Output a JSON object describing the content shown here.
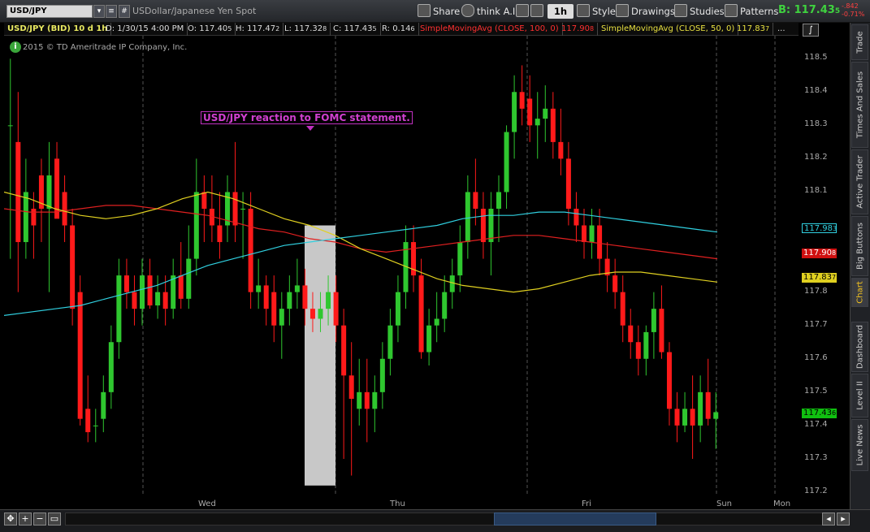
{
  "toolbar": {
    "symbol": "USD/JPY",
    "description": "USDollar/Japanese Yen Spot",
    "share_label": "Share",
    "think_label": "think A.I.",
    "interval_label": "1h",
    "style_label": "Style",
    "drawings_label": "Drawings",
    "studies_label": "Studies",
    "patterns_label": "Patterns",
    "bid_label": "B: 117.43",
    "bid_small": "5",
    "change_pct_top": "-.842",
    "change_pct_bottom": "-0.71%"
  },
  "infobar": {
    "title": "USD/JPY (BID) 10 d 1h",
    "datetime": "D: 1/30/15 4:00 PM",
    "open": "O: 117.40",
    "open_small": "5",
    "high": "H: 117.47",
    "high_small": "2",
    "low": "L: 117.32",
    "low_small": "8",
    "close": "C: 117.43",
    "close_small": "5",
    "range": "R: 0.14",
    "range_small": "6",
    "sma100_label": "SimpleMovingAvg (CLOSE, 100, 0)",
    "sma100_value": "117.90",
    "sma100_small": "8",
    "sma50_label": "SimpleMovingAvg (CLOSE, 50, 0)",
    "sma50_value": "117.83",
    "sma50_small": "7",
    "more": "..."
  },
  "copyright": "2015 © TD Ameritrade IP Company, Inc.",
  "annotation": "USD/JPY reaction to FOMC statement.",
  "price_labels": [
    "118.5",
    "118.4",
    "118.3",
    "118.2",
    "118.1",
    "117.8",
    "117.7",
    "117.6",
    "117.5",
    "117.4",
    "117.3",
    "117.2"
  ],
  "price_tags": {
    "cyan": "117.98",
    "cyan_small": "3",
    "red": "117.90",
    "red_small": "8",
    "yellow": "117.83",
    "yellow_small": "7",
    "green": "117.43",
    "green_small": "6"
  },
  "x_labels": [
    "Wed",
    "Thu",
    "Fri",
    "Sun",
    "Mon"
  ],
  "side_tabs": [
    "Trade",
    "Times And Sales",
    "Active Trader",
    "Big Buttons",
    "Chart",
    "Dashboard",
    "Level II",
    "Live News"
  ],
  "colors": {
    "up": "#2fc72f",
    "down": "#ff1a1a",
    "sma_red": "#e02020",
    "sma_yellow": "#e0d020",
    "sma_cyan": "#30d0e0",
    "highlight": "#c8c8c8"
  },
  "chart_data": {
    "type": "candlestick",
    "ylim": [
      117.2,
      118.52
    ],
    "candles": [
      [
        118.3,
        118.5,
        117.9,
        118.3
      ],
      [
        118.25,
        118.4,
        117.8,
        117.95
      ],
      [
        117.95,
        118.2,
        117.9,
        118.1
      ],
      [
        118.05,
        118.1,
        117.9,
        118.0
      ],
      [
        118.15,
        118.2,
        117.95,
        118.05
      ],
      [
        118.05,
        118.25,
        117.8,
        118.15
      ],
      [
        118.2,
        118.25,
        118.05,
        118.02
      ],
      [
        118.1,
        118.15,
        117.95,
        118.0
      ],
      [
        118.0,
        118.05,
        117.7,
        117.75
      ],
      [
        117.8,
        117.85,
        117.4,
        117.42
      ],
      [
        117.45,
        117.55,
        117.35,
        117.38
      ],
      [
        117.4,
        117.45,
        117.35,
        117.4
      ],
      [
        117.42,
        117.55,
        117.38,
        117.5
      ],
      [
        117.5,
        117.7,
        117.45,
        117.65
      ],
      [
        117.65,
        117.9,
        117.6,
        117.85
      ],
      [
        117.85,
        117.9,
        117.75,
        117.8
      ],
      [
        117.8,
        117.85,
        117.7,
        117.75
      ],
      [
        117.75,
        117.9,
        117.7,
        117.85
      ],
      [
        117.85,
        117.9,
        117.75,
        117.76
      ],
      [
        117.76,
        117.85,
        117.72,
        117.8
      ],
      [
        117.8,
        117.85,
        117.7,
        117.75
      ],
      [
        117.75,
        117.9,
        117.72,
        117.85
      ],
      [
        117.85,
        117.95,
        117.75,
        117.78
      ],
      [
        117.78,
        118.0,
        117.75,
        117.9
      ],
      [
        117.9,
        118.2,
        117.85,
        118.1
      ],
      [
        118.1,
        118.15,
        117.95,
        118.05
      ],
      [
        118.05,
        118.15,
        117.95,
        118.0
      ],
      [
        118.0,
        118.1,
        117.9,
        117.95
      ],
      [
        118.0,
        118.15,
        117.95,
        118.1
      ],
      [
        118.1,
        118.25,
        117.95,
        118.0
      ],
      [
        118.05,
        118.1,
        117.9,
        118.05
      ],
      [
        118.05,
        118.1,
        117.75,
        117.8
      ],
      [
        117.8,
        117.9,
        117.75,
        117.82
      ],
      [
        117.82,
        117.85,
        117.7,
        117.75
      ],
      [
        117.8,
        117.85,
        117.65,
        117.7
      ],
      [
        117.7,
        117.8,
        117.6,
        117.75
      ],
      [
        117.75,
        117.85,
        117.7,
        117.8
      ],
      [
        117.8,
        117.9,
        117.75,
        117.82
      ],
      [
        117.82,
        117.87,
        117.7,
        117.75
      ],
      [
        117.75,
        117.8,
        117.68,
        117.72
      ],
      [
        117.72,
        117.8,
        117.68,
        117.75
      ],
      [
        117.75,
        117.85,
        117.7,
        117.8
      ],
      [
        117.8,
        117.85,
        117.65,
        117.7
      ],
      [
        117.7,
        117.75,
        117.3,
        117.55
      ],
      [
        117.55,
        117.65,
        117.25,
        117.48
      ],
      [
        117.45,
        117.6,
        117.4,
        117.5
      ],
      [
        117.5,
        117.6,
        117.35,
        117.45
      ],
      [
        117.45,
        117.55,
        117.38,
        117.5
      ],
      [
        117.5,
        117.65,
        117.45,
        117.6
      ],
      [
        117.6,
        117.75,
        117.55,
        117.7
      ],
      [
        117.7,
        117.85,
        117.65,
        117.8
      ],
      [
        117.8,
        118.0,
        117.75,
        117.95
      ],
      [
        117.95,
        118.0,
        117.8,
        117.85
      ],
      [
        117.85,
        117.9,
        117.6,
        117.62
      ],
      [
        117.62,
        117.75,
        117.58,
        117.7
      ],
      [
        117.7,
        117.8,
        117.65,
        117.72
      ],
      [
        117.72,
        117.85,
        117.68,
        117.8
      ],
      [
        117.8,
        117.9,
        117.75,
        117.85
      ],
      [
        117.85,
        118.0,
        117.8,
        117.95
      ],
      [
        117.95,
        118.15,
        117.9,
        118.1
      ],
      [
        118.1,
        118.2,
        118.0,
        118.05
      ],
      [
        118.05,
        118.1,
        117.9,
        117.95
      ],
      [
        117.95,
        118.1,
        117.85,
        118.05
      ],
      [
        118.05,
        118.15,
        117.95,
        118.1
      ],
      [
        118.1,
        118.3,
        118.05,
        118.28
      ],
      [
        118.28,
        118.45,
        118.2,
        118.4
      ],
      [
        118.4,
        118.48,
        118.3,
        118.35
      ],
      [
        118.38,
        118.45,
        118.25,
        118.3
      ],
      [
        118.3,
        118.4,
        118.2,
        118.32
      ],
      [
        118.32,
        118.42,
        118.25,
        118.35
      ],
      [
        118.35,
        118.4,
        118.2,
        118.25
      ],
      [
        118.25,
        118.35,
        118.15,
        118.2
      ],
      [
        118.2,
        118.25,
        118.0,
        118.05
      ],
      [
        118.05,
        118.1,
        117.95,
        118.0
      ],
      [
        118.0,
        118.05,
        117.9,
        117.95
      ],
      [
        117.95,
        118.05,
        117.9,
        118.0
      ],
      [
        118.0,
        118.05,
        117.85,
        117.9
      ],
      [
        117.9,
        117.95,
        117.8,
        117.85
      ],
      [
        117.85,
        117.9,
        117.75,
        117.8
      ],
      [
        117.8,
        117.85,
        117.65,
        117.7
      ],
      [
        117.7,
        117.75,
        117.6,
        117.65
      ],
      [
        117.65,
        117.7,
        117.55,
        117.6
      ],
      [
        117.6,
        117.7,
        117.55,
        117.68
      ],
      [
        117.68,
        117.8,
        117.6,
        117.75
      ],
      [
        117.75,
        117.82,
        117.6,
        117.62
      ],
      [
        117.62,
        117.65,
        117.4,
        117.45
      ],
      [
        117.45,
        117.5,
        117.35,
        117.4
      ],
      [
        117.4,
        117.5,
        117.38,
        117.45
      ],
      [
        117.45,
        117.55,
        117.3,
        117.4
      ],
      [
        117.4,
        117.55,
        117.35,
        117.5
      ],
      [
        117.5,
        117.6,
        117.4,
        117.42
      ],
      [
        117.42,
        117.5,
        117.33,
        117.44
      ]
    ],
    "sma50": [
      118.1,
      118.08,
      118.05,
      118.03,
      118.02,
      118.03,
      118.05,
      118.08,
      118.1,
      118.08,
      118.05,
      118.02,
      118.0,
      117.97,
      117.93,
      117.9,
      117.87,
      117.84,
      117.82,
      117.81,
      117.8,
      117.81,
      117.83,
      117.85,
      117.86,
      117.86,
      117.85,
      117.84,
      117.83
    ],
    "sma100": [
      118.05,
      118.04,
      118.04,
      118.05,
      118.06,
      118.06,
      118.05,
      118.04,
      118.03,
      118.01,
      117.99,
      117.98,
      117.96,
      117.95,
      117.93,
      117.92,
      117.93,
      117.94,
      117.95,
      117.96,
      117.97,
      117.97,
      117.96,
      117.95,
      117.94,
      117.93,
      117.92,
      117.91,
      117.9
    ],
    "sma_cyan": [
      117.73,
      117.74,
      117.75,
      117.76,
      117.78,
      117.8,
      117.82,
      117.85,
      117.88,
      117.9,
      117.92,
      117.94,
      117.95,
      117.96,
      117.97,
      117.98,
      117.99,
      118.0,
      118.02,
      118.03,
      118.03,
      118.04,
      118.04,
      118.03,
      118.02,
      118.01,
      118.0,
      117.99,
      117.98
    ]
  }
}
